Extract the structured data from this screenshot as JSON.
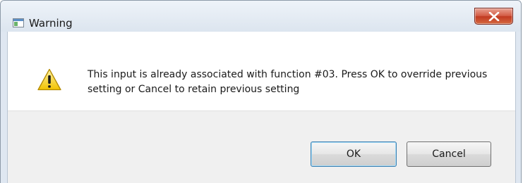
{
  "window": {
    "title": "Warning",
    "title_icon": "window-icon",
    "close_icon": "close-icon"
  },
  "message": {
    "icon": "warning-icon",
    "text": "This input is already associated with function #03. Press OK to override previous setting or Cancel to retain previous setting"
  },
  "buttons": {
    "ok_label": "OK",
    "cancel_label": "Cancel"
  },
  "colors": {
    "close_button": "#c13a22",
    "warning_icon": "#f2c200",
    "default_button_border": "#3c7fb1"
  }
}
